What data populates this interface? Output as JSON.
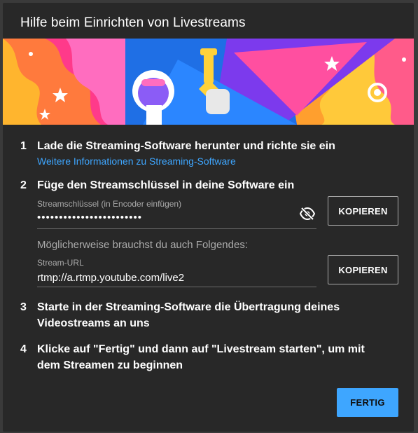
{
  "dialog": {
    "title": "Hilfe beim Einrichten von Livestreams"
  },
  "steps": [
    {
      "number": "1",
      "text": "Lade die Streaming-Software herunter und richte sie ein",
      "link": "Weitere Informationen zu Streaming-Software"
    },
    {
      "number": "2",
      "text": "Füge den Streamschlüssel in deine Software ein",
      "key_label": "Streamschlüssel (in Encoder einfügen)",
      "key_value": "••••••••••••••••••••••••",
      "copy_key_label": "KOPIEREN",
      "hint": "Möglicherweise brauchst du auch Folgendes:",
      "url_label": "Stream-URL",
      "url_value": "rtmp://a.rtmp.youtube.com/live2",
      "copy_url_label": "KOPIEREN"
    },
    {
      "number": "3",
      "text_line1": "Starte in der Streaming-Software die Übertragung deines",
      "text_line2": "Videostreams an uns"
    },
    {
      "number": "4",
      "text_line1": "Klicke auf \"Fertig\" und dann auf \"Livestream starten\", um mit",
      "text_line2": "dem Streamen zu beginnen"
    }
  ],
  "footer": {
    "done_label": "FERTIG"
  },
  "colors": {
    "dialog_bg": "#282828",
    "accent": "#3ea6ff",
    "muted_text": "#aaaaaa"
  },
  "icons": {
    "visibility": "eye-off-icon"
  }
}
